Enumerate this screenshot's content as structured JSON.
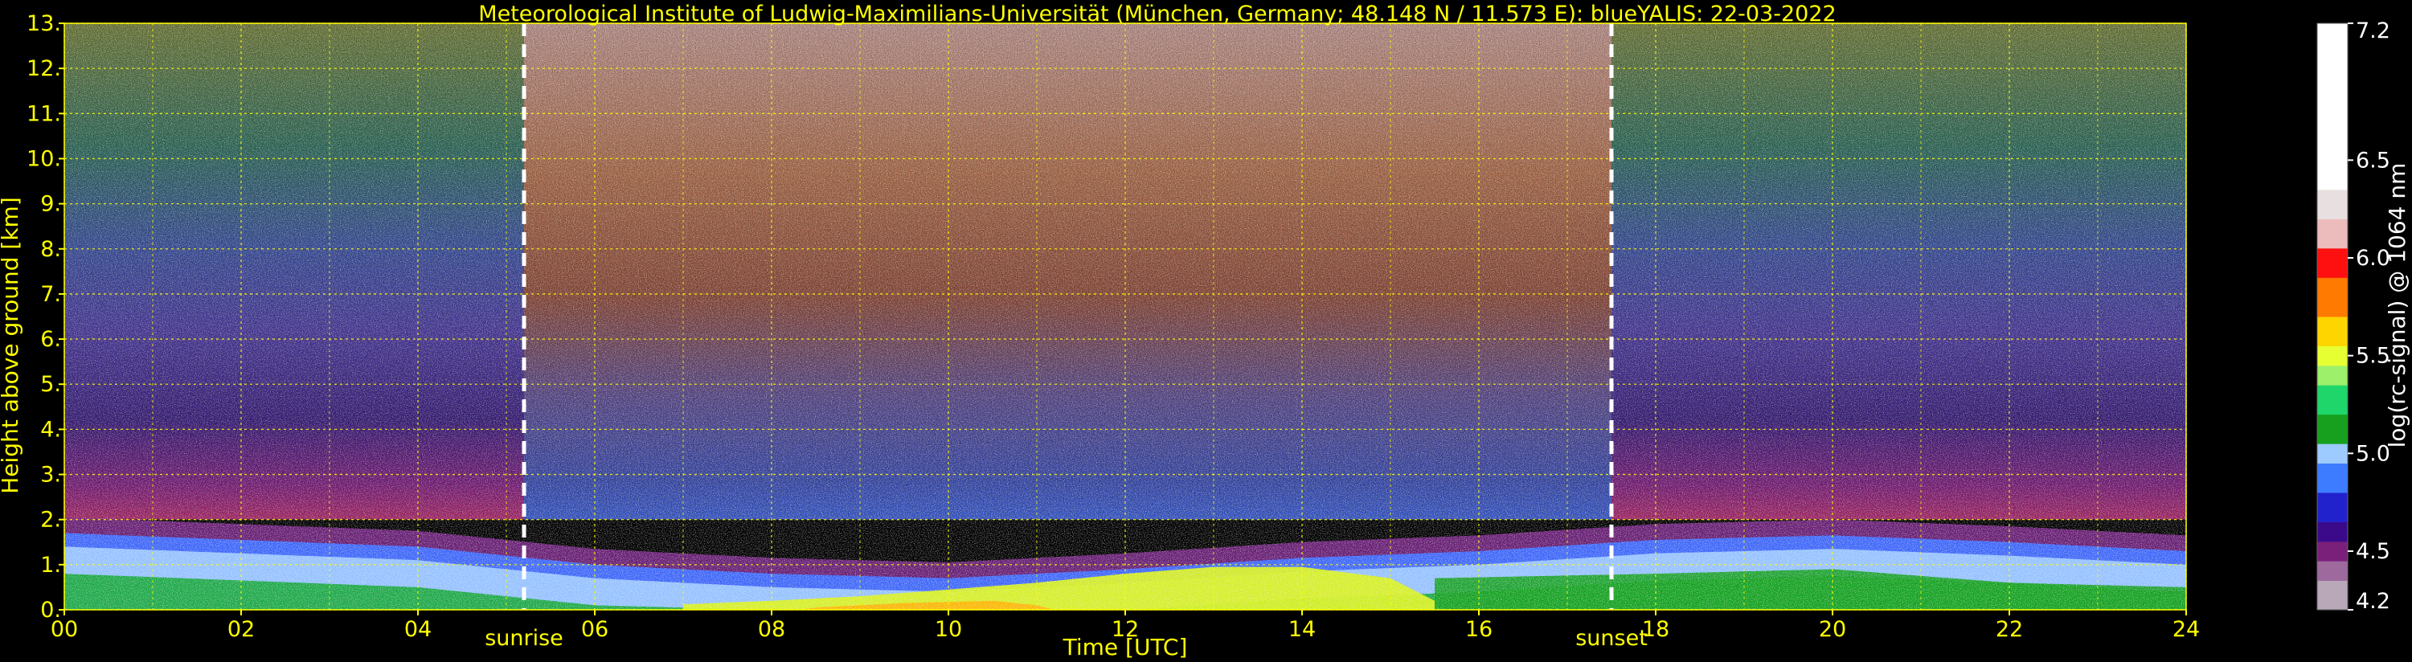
{
  "chart_data": {
    "type": "heatmap",
    "title": "Meteorological Institute of Ludwig-Maximilians-Universität (München, Germany; 48.148 N / 11.573 E):     blueYALIS: 22-03-2022",
    "xlabel": "Time [UTC]",
    "ylabel": "Height above ground [km]",
    "xlim": [
      0,
      24
    ],
    "ylim": [
      0,
      13
    ],
    "x_ticks": [
      "00",
      "02",
      "04",
      "06",
      "08",
      "10",
      "12",
      "14",
      "16",
      "18",
      "20",
      "22",
      "24"
    ],
    "x_tick_values": [
      0,
      2,
      4,
      6,
      8,
      10,
      12,
      14,
      16,
      18,
      20,
      22,
      24
    ],
    "y_ticks": [
      "0.",
      "1.",
      "2.",
      "3.",
      "4.",
      "5.",
      "6.",
      "7.",
      "8.",
      "9.",
      "10.",
      "11.",
      "12.",
      "13."
    ],
    "y_tick_values": [
      0,
      1,
      2,
      3,
      4,
      5,
      6,
      7,
      8,
      9,
      10,
      11,
      12,
      13
    ],
    "grid": true,
    "grid_color": "#ffff00",
    "annotations": [
      {
        "label": "sunrise",
        "x": 5.2
      },
      {
        "label": "sunset",
        "x": 17.5
      }
    ],
    "colorbar": {
      "label": "log(rc-signal) @ 1064 nm",
      "range": [
        4.2,
        7.2
      ],
      "tick_labels": [
        "4.2",
        "4.5",
        "5.0",
        "5.5",
        "6.0",
        "6.5",
        "7.2"
      ],
      "tick_values": [
        4.2,
        4.5,
        5.0,
        5.5,
        6.0,
        6.5,
        7.2
      ],
      "colors": [
        {
          "v": 4.2,
          "c": "#b8a8b8"
        },
        {
          "v": 4.35,
          "c": "#9e6a9e"
        },
        {
          "v": 4.45,
          "c": "#7a1f7a"
        },
        {
          "v": 4.55,
          "c": "#3a0a8a"
        },
        {
          "v": 4.65,
          "c": "#2222cc"
        },
        {
          "v": 4.8,
          "c": "#3d7bff"
        },
        {
          "v": 4.95,
          "c": "#9ecbff"
        },
        {
          "v": 5.05,
          "c": "#17a01e"
        },
        {
          "v": 5.2,
          "c": "#1fd66a"
        },
        {
          "v": 5.35,
          "c": "#9df06a"
        },
        {
          "v": 5.45,
          "c": "#e6ff33"
        },
        {
          "v": 5.55,
          "c": "#ffd500"
        },
        {
          "v": 5.7,
          "c": "#ff7a00"
        },
        {
          "v": 5.9,
          "c": "#ff1010"
        },
        {
          "v": 6.05,
          "c": "#ecbcbc"
        },
        {
          "v": 6.2,
          "c": "#e8e0e0"
        },
        {
          "v": 6.35,
          "c": "#ffffff"
        },
        {
          "v": 7.2,
          "c": "#ffffff"
        }
      ]
    },
    "signal_regions": [
      {
        "name": "night-aloft",
        "description_value": 4.5,
        "x": [
          0,
          5.2
        ],
        "y": [
          2,
          13
        ]
      },
      {
        "name": "day-aloft",
        "description_value": 6.0,
        "x": [
          5.2,
          17.5
        ],
        "y": [
          2,
          13
        ]
      },
      {
        "name": "evening-aloft",
        "description_value": 4.5,
        "x": [
          17.5,
          24
        ],
        "y": [
          2,
          13
        ]
      },
      {
        "name": "boundary-layer",
        "description_value": 5.1,
        "x": [
          0,
          24
        ],
        "y": [
          0,
          1.8
        ]
      },
      {
        "name": "daytime-aerosol-maximum",
        "description_value": 5.5,
        "x": [
          7,
          15.5
        ],
        "y": [
          0,
          1.0
        ]
      }
    ],
    "pbl_top_km": [
      {
        "x": 0,
        "y": 1.7
      },
      {
        "x": 2,
        "y": 1.55
      },
      {
        "x": 4,
        "y": 1.4
      },
      {
        "x": 6,
        "y": 1.0
      },
      {
        "x": 8,
        "y": 0.8
      },
      {
        "x": 10,
        "y": 0.7
      },
      {
        "x": 12,
        "y": 0.9
      },
      {
        "x": 14,
        "y": 1.15
      },
      {
        "x": 16,
        "y": 1.3
      },
      {
        "x": 18,
        "y": 1.55
      },
      {
        "x": 20,
        "y": 1.65
      },
      {
        "x": 22,
        "y": 1.5
      },
      {
        "x": 24,
        "y": 1.3
      }
    ]
  }
}
